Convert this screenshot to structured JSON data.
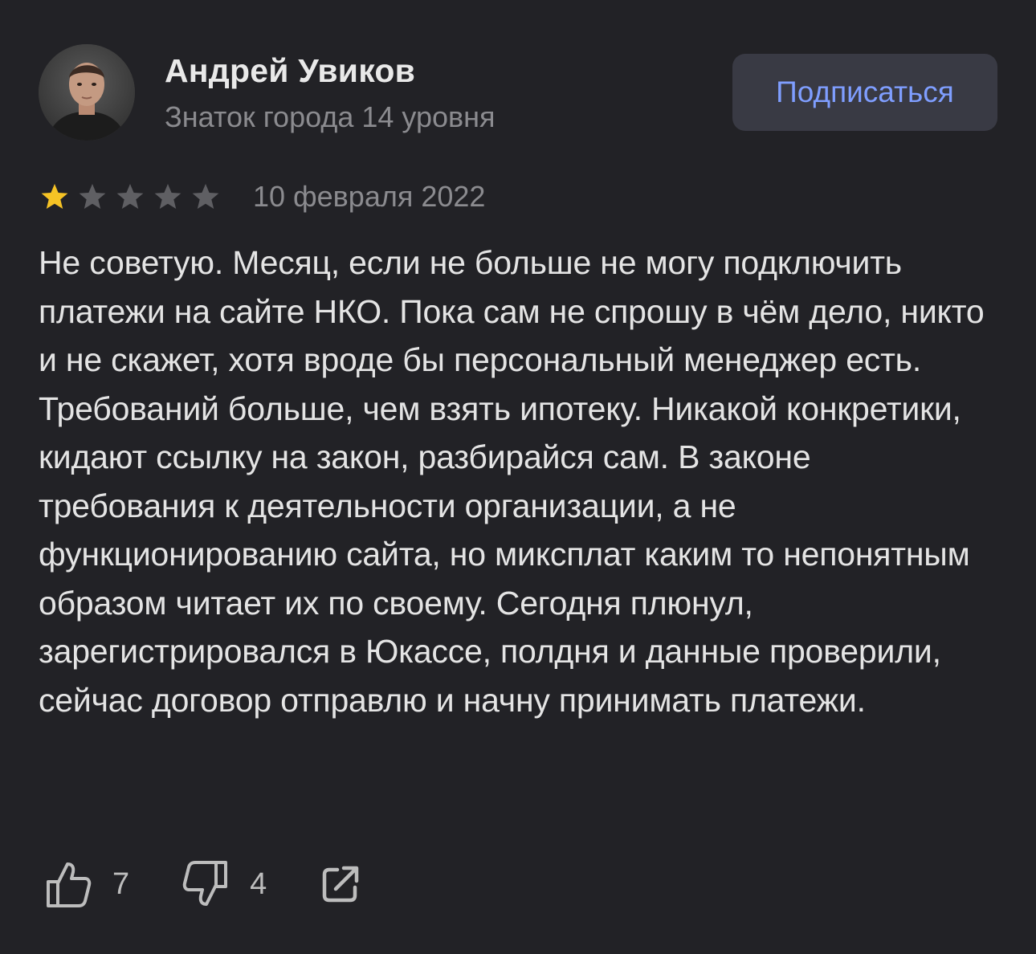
{
  "author": {
    "name": "Андрей Увиков",
    "level": "Знаток города 14 уровня"
  },
  "subscribe_label": "Подписаться",
  "review": {
    "rating": 1,
    "max_rating": 5,
    "date": "10 февраля 2022",
    "text": "Не советую. Месяц, если не больше не могу подключить платежи на сайте НКО. Пока сам не спрошу в чём дело, никто и не скажет, хотя вроде бы персональный менеджер есть. Требований больше, чем взять ипотеку. Никакой конкретики, кидают ссылку на закон, разбирайся сам. В законе требования к деятельности организации, а не функционированию сайта, но миксплат каким то непонятным образом читает их по своему. Сегодня плюнул, зарегистрировался в Юкассе, полдня и данные проверили, сейчас договор отправлю и начну принимать платежи."
  },
  "actions": {
    "likes": "7",
    "dislikes": "4",
    "like_icon": "thumbs-up-icon",
    "dislike_icon": "thumbs-down-icon",
    "share_icon": "share-icon"
  },
  "colors": {
    "background": "#222226",
    "star_filled": "#f6c325",
    "star_empty": "#5f5f63",
    "accent": "#7f9eff"
  }
}
